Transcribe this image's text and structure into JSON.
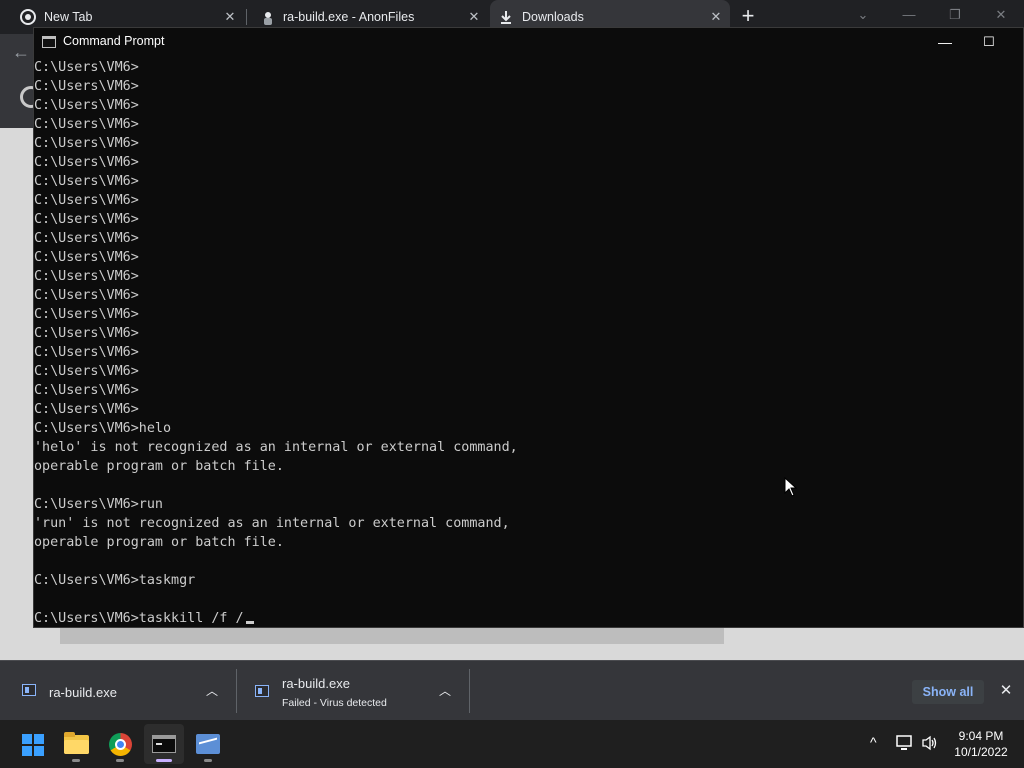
{
  "browser": {
    "tabs": [
      {
        "title": "New Tab",
        "icon": "chrome-icon"
      },
      {
        "title": "ra-build.exe - AnonFiles",
        "icon": "anonfiles-icon"
      },
      {
        "title": "Downloads",
        "icon": "download-icon"
      }
    ],
    "new_tab": "+"
  },
  "cmd": {
    "title": "Command Prompt",
    "lines": [
      "C:\\Users\\VM6>",
      "C:\\Users\\VM6>",
      "C:\\Users\\VM6>",
      "C:\\Users\\VM6>",
      "C:\\Users\\VM6>",
      "C:\\Users\\VM6>",
      "C:\\Users\\VM6>",
      "C:\\Users\\VM6>",
      "C:\\Users\\VM6>",
      "C:\\Users\\VM6>",
      "C:\\Users\\VM6>",
      "C:\\Users\\VM6>",
      "C:\\Users\\VM6>",
      "C:\\Users\\VM6>",
      "C:\\Users\\VM6>",
      "C:\\Users\\VM6>",
      "C:\\Users\\VM6>",
      "C:\\Users\\VM6>",
      "C:\\Users\\VM6>",
      "C:\\Users\\VM6>helo",
      "'helo' is not recognized as an internal or external command,",
      "operable program or batch file.",
      "",
      "C:\\Users\\VM6>run",
      "'run' is not recognized as an internal or external command,",
      "operable program or batch file.",
      "",
      "C:\\Users\\VM6>taskmgr",
      "",
      "C:\\Users\\VM6>taskkill /f /"
    ]
  },
  "downloads": {
    "items": [
      {
        "name": "ra-build.exe",
        "status": ""
      },
      {
        "name": "ra-build.exe",
        "status": "Failed - Virus detected"
      }
    ],
    "show_all": "Show all"
  },
  "taskbar": {
    "apps": [
      {
        "name": "start-button",
        "icon": "windows-icon"
      },
      {
        "name": "file-explorer",
        "icon": "folder-icon"
      },
      {
        "name": "google-chrome",
        "icon": "chrome-icon"
      },
      {
        "name": "command-prompt",
        "icon": "cmd-icon"
      },
      {
        "name": "performance-monitor",
        "icon": "chart-icon"
      }
    ],
    "time": "9:04 PM",
    "date": "10/1/2022"
  },
  "colors": {
    "console_bg": "#0c0c0c",
    "console_text": "#cccccc",
    "shelf_bg": "#35363a",
    "accent_link": "#8ab4f8"
  }
}
